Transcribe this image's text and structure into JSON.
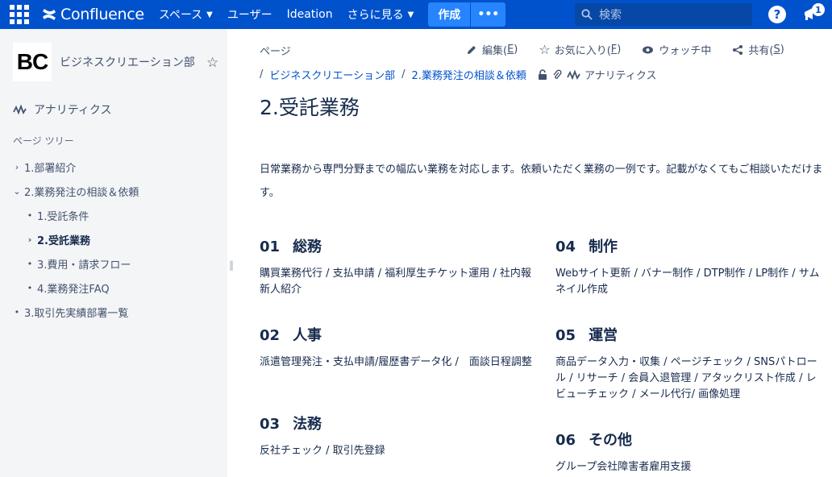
{
  "topbar": {
    "logo": "Confluence",
    "nav": [
      {
        "label": "スペース",
        "dropdown": true
      },
      {
        "label": "ユーザー",
        "dropdown": false
      },
      {
        "label": "Ideation",
        "dropdown": false
      },
      {
        "label": "さらに見る",
        "dropdown": true
      }
    ],
    "create_label": "作成",
    "more_label": "•••",
    "search_placeholder": "検索",
    "help_label": "?",
    "notification_count": "1"
  },
  "sidebar": {
    "space_logo": "BC",
    "space_name": "ビジネスクリエーション部",
    "analytics_label": "アナリティクス",
    "tree_label": "ページ ツリー",
    "tree": [
      {
        "label": "1.部署紹介",
        "twisty": "›",
        "level": 0,
        "active": false
      },
      {
        "label": "2.業務発注の相談＆依頼",
        "twisty": "⌄",
        "level": 0,
        "active": false
      },
      {
        "label": "1.受託条件",
        "twisty": "•",
        "level": 1,
        "active": false
      },
      {
        "label": "2.受託業務",
        "twisty": "›",
        "level": 1,
        "active": true
      },
      {
        "label": "3.費用・請求フロー",
        "twisty": "•",
        "level": 1,
        "active": false
      },
      {
        "label": "4.業務発注FAQ",
        "twisty": "•",
        "level": 1,
        "active": false
      },
      {
        "label": "3.取引先実績部署一覧",
        "twisty": "•",
        "level": 0,
        "active": false
      }
    ]
  },
  "main": {
    "breadcrumb_top": "ページ",
    "actions": {
      "edit": "編集(",
      "edit_key": "E",
      "favorite": "お気に入り(",
      "favorite_key": "F",
      "watch": "ウォッチ中",
      "share": "共有(",
      "share_key": "S",
      "close_paren": ")"
    },
    "crumbs": [
      "ビジネスクリエーション部",
      "2.業務発注の相談＆依頼"
    ],
    "crumb_sep": "/",
    "analytics_label": "アナリティクス",
    "title": "2.受託業務",
    "intro": "日常業務から専門分野までの幅広い業務を対応します。依頼いただく業務の一例です。記載がなくてもご相談いただけます。",
    "sections": [
      {
        "num": "01",
        "title": "総務",
        "body": "購買業務代行 / 支払申請 / 福利厚生チケット運用 / 社内報新人紹介"
      },
      {
        "num": "02",
        "title": "人事",
        "body": "派遣管理発注・支払申請/履歴書データ化 /　面談日程調整"
      },
      {
        "num": "03",
        "title": "法務",
        "body": "反社チェック / 取引先登録"
      },
      {
        "num": "04",
        "title": "制作",
        "body": "Webサイト更新 / バナー制作 / DTP制作 / LP制作 / サムネイル作成"
      },
      {
        "num": "05",
        "title": "運営",
        "body": "商品データ入力・収集 / ページチェック / SNSパトロール / リサーチ / 会員入退管理 / アタックリスト作成 / レビューチェック / メール代行/ 画像処理"
      },
      {
        "num": "06",
        "title": "その他",
        "body": "グループ会社障害者雇用支援"
      }
    ]
  }
}
